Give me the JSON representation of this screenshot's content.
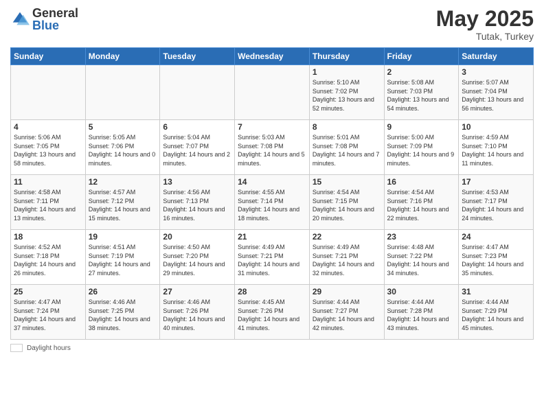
{
  "header": {
    "logo_general": "General",
    "logo_blue": "Blue",
    "month_title": "May 2025",
    "location": "Tutak, Turkey"
  },
  "weekdays": [
    "Sunday",
    "Monday",
    "Tuesday",
    "Wednesday",
    "Thursday",
    "Friday",
    "Saturday"
  ],
  "footer": {
    "label": "Daylight hours"
  },
  "weeks": [
    [
      {
        "day": "",
        "sunrise": "",
        "sunset": "",
        "daylight": ""
      },
      {
        "day": "",
        "sunrise": "",
        "sunset": "",
        "daylight": ""
      },
      {
        "day": "",
        "sunrise": "",
        "sunset": "",
        "daylight": ""
      },
      {
        "day": "",
        "sunrise": "",
        "sunset": "",
        "daylight": ""
      },
      {
        "day": "1",
        "sunrise": "Sunrise: 5:10 AM",
        "sunset": "Sunset: 7:02 PM",
        "daylight": "Daylight: 13 hours and 52 minutes."
      },
      {
        "day": "2",
        "sunrise": "Sunrise: 5:08 AM",
        "sunset": "Sunset: 7:03 PM",
        "daylight": "Daylight: 13 hours and 54 minutes."
      },
      {
        "day": "3",
        "sunrise": "Sunrise: 5:07 AM",
        "sunset": "Sunset: 7:04 PM",
        "daylight": "Daylight: 13 hours and 56 minutes."
      }
    ],
    [
      {
        "day": "4",
        "sunrise": "Sunrise: 5:06 AM",
        "sunset": "Sunset: 7:05 PM",
        "daylight": "Daylight: 13 hours and 58 minutes."
      },
      {
        "day": "5",
        "sunrise": "Sunrise: 5:05 AM",
        "sunset": "Sunset: 7:06 PM",
        "daylight": "Daylight: 14 hours and 0 minutes."
      },
      {
        "day": "6",
        "sunrise": "Sunrise: 5:04 AM",
        "sunset": "Sunset: 7:07 PM",
        "daylight": "Daylight: 14 hours and 2 minutes."
      },
      {
        "day": "7",
        "sunrise": "Sunrise: 5:03 AM",
        "sunset": "Sunset: 7:08 PM",
        "daylight": "Daylight: 14 hours and 5 minutes."
      },
      {
        "day": "8",
        "sunrise": "Sunrise: 5:01 AM",
        "sunset": "Sunset: 7:08 PM",
        "daylight": "Daylight: 14 hours and 7 minutes."
      },
      {
        "day": "9",
        "sunrise": "Sunrise: 5:00 AM",
        "sunset": "Sunset: 7:09 PM",
        "daylight": "Daylight: 14 hours and 9 minutes."
      },
      {
        "day": "10",
        "sunrise": "Sunrise: 4:59 AM",
        "sunset": "Sunset: 7:10 PM",
        "daylight": "Daylight: 14 hours and 11 minutes."
      }
    ],
    [
      {
        "day": "11",
        "sunrise": "Sunrise: 4:58 AM",
        "sunset": "Sunset: 7:11 PM",
        "daylight": "Daylight: 14 hours and 13 minutes."
      },
      {
        "day": "12",
        "sunrise": "Sunrise: 4:57 AM",
        "sunset": "Sunset: 7:12 PM",
        "daylight": "Daylight: 14 hours and 15 minutes."
      },
      {
        "day": "13",
        "sunrise": "Sunrise: 4:56 AM",
        "sunset": "Sunset: 7:13 PM",
        "daylight": "Daylight: 14 hours and 16 minutes."
      },
      {
        "day": "14",
        "sunrise": "Sunrise: 4:55 AM",
        "sunset": "Sunset: 7:14 PM",
        "daylight": "Daylight: 14 hours and 18 minutes."
      },
      {
        "day": "15",
        "sunrise": "Sunrise: 4:54 AM",
        "sunset": "Sunset: 7:15 PM",
        "daylight": "Daylight: 14 hours and 20 minutes."
      },
      {
        "day": "16",
        "sunrise": "Sunrise: 4:54 AM",
        "sunset": "Sunset: 7:16 PM",
        "daylight": "Daylight: 14 hours and 22 minutes."
      },
      {
        "day": "17",
        "sunrise": "Sunrise: 4:53 AM",
        "sunset": "Sunset: 7:17 PM",
        "daylight": "Daylight: 14 hours and 24 minutes."
      }
    ],
    [
      {
        "day": "18",
        "sunrise": "Sunrise: 4:52 AM",
        "sunset": "Sunset: 7:18 PM",
        "daylight": "Daylight: 14 hours and 26 minutes."
      },
      {
        "day": "19",
        "sunrise": "Sunrise: 4:51 AM",
        "sunset": "Sunset: 7:19 PM",
        "daylight": "Daylight: 14 hours and 27 minutes."
      },
      {
        "day": "20",
        "sunrise": "Sunrise: 4:50 AM",
        "sunset": "Sunset: 7:20 PM",
        "daylight": "Daylight: 14 hours and 29 minutes."
      },
      {
        "day": "21",
        "sunrise": "Sunrise: 4:49 AM",
        "sunset": "Sunset: 7:21 PM",
        "daylight": "Daylight: 14 hours and 31 minutes."
      },
      {
        "day": "22",
        "sunrise": "Sunrise: 4:49 AM",
        "sunset": "Sunset: 7:21 PM",
        "daylight": "Daylight: 14 hours and 32 minutes."
      },
      {
        "day": "23",
        "sunrise": "Sunrise: 4:48 AM",
        "sunset": "Sunset: 7:22 PM",
        "daylight": "Daylight: 14 hours and 34 minutes."
      },
      {
        "day": "24",
        "sunrise": "Sunrise: 4:47 AM",
        "sunset": "Sunset: 7:23 PM",
        "daylight": "Daylight: 14 hours and 35 minutes."
      }
    ],
    [
      {
        "day": "25",
        "sunrise": "Sunrise: 4:47 AM",
        "sunset": "Sunset: 7:24 PM",
        "daylight": "Daylight: 14 hours and 37 minutes."
      },
      {
        "day": "26",
        "sunrise": "Sunrise: 4:46 AM",
        "sunset": "Sunset: 7:25 PM",
        "daylight": "Daylight: 14 hours and 38 minutes."
      },
      {
        "day": "27",
        "sunrise": "Sunrise: 4:46 AM",
        "sunset": "Sunset: 7:26 PM",
        "daylight": "Daylight: 14 hours and 40 minutes."
      },
      {
        "day": "28",
        "sunrise": "Sunrise: 4:45 AM",
        "sunset": "Sunset: 7:26 PM",
        "daylight": "Daylight: 14 hours and 41 minutes."
      },
      {
        "day": "29",
        "sunrise": "Sunrise: 4:44 AM",
        "sunset": "Sunset: 7:27 PM",
        "daylight": "Daylight: 14 hours and 42 minutes."
      },
      {
        "day": "30",
        "sunrise": "Sunrise: 4:44 AM",
        "sunset": "Sunset: 7:28 PM",
        "daylight": "Daylight: 14 hours and 43 minutes."
      },
      {
        "day": "31",
        "sunrise": "Sunrise: 4:44 AM",
        "sunset": "Sunset: 7:29 PM",
        "daylight": "Daylight: 14 hours and 45 minutes."
      }
    ]
  ]
}
